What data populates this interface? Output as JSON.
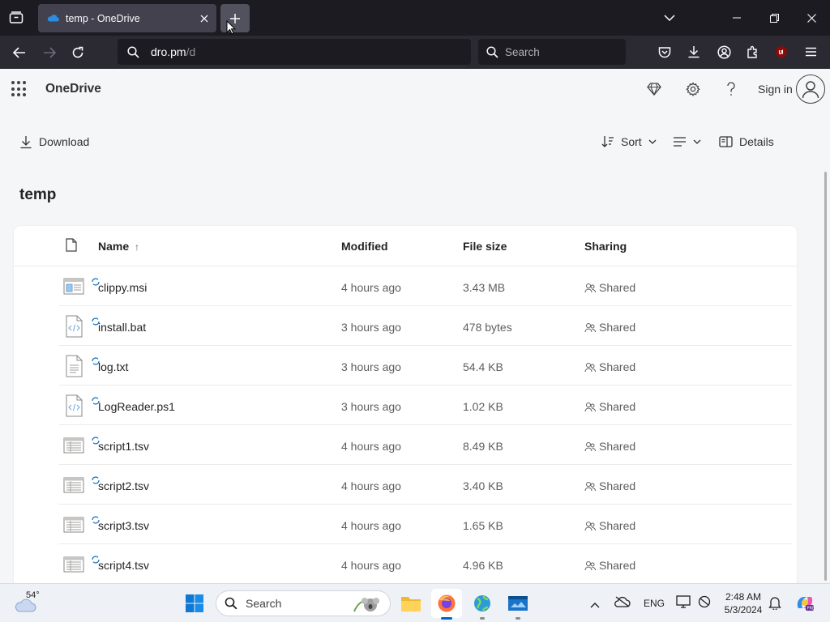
{
  "browser": {
    "tab_title": "temp - OneDrive",
    "url_host": "dro.pm",
    "url_path": "/d",
    "search_placeholder": "Search",
    "colors": {
      "tabbar": "#1c1b22",
      "toolbar": "#2b2a33",
      "active_tab": "#42414d"
    }
  },
  "app": {
    "name": "OneDrive",
    "signin_label": "Sign in"
  },
  "commandbar": {
    "download_label": "Download",
    "sort_label": "Sort",
    "details_label": "Details"
  },
  "folder": {
    "title": "temp"
  },
  "file_list": {
    "columns": {
      "name": "Name",
      "modified": "Modified",
      "size": "File size",
      "sharing": "Sharing"
    },
    "sort_indicator": "↑",
    "rows": [
      {
        "name": "clippy.msi",
        "modified": "4 hours ago",
        "size": "3.43 MB",
        "sharing": "Shared",
        "icon": "msi-file-icon"
      },
      {
        "name": "install.bat",
        "modified": "3 hours ago",
        "size": "478 bytes",
        "sharing": "Shared",
        "icon": "code-file-icon"
      },
      {
        "name": "log.txt",
        "modified": "3 hours ago",
        "size": "54.4 KB",
        "sharing": "Shared",
        "icon": "text-file-icon"
      },
      {
        "name": "LogReader.ps1",
        "modified": "3 hours ago",
        "size": "1.02 KB",
        "sharing": "Shared",
        "icon": "code-file-icon"
      },
      {
        "name": "script1.tsv",
        "modified": "4 hours ago",
        "size": "8.49 KB",
        "sharing": "Shared",
        "icon": "spreadsheet-file-icon"
      },
      {
        "name": "script2.tsv",
        "modified": "4 hours ago",
        "size": "3.40 KB",
        "sharing": "Shared",
        "icon": "spreadsheet-file-icon"
      },
      {
        "name": "script3.tsv",
        "modified": "4 hours ago",
        "size": "1.65 KB",
        "sharing": "Shared",
        "icon": "spreadsheet-file-icon"
      },
      {
        "name": "script4.tsv",
        "modified": "4 hours ago",
        "size": "4.96 KB",
        "sharing": "Shared",
        "icon": "spreadsheet-file-icon"
      }
    ]
  },
  "taskbar": {
    "weather_temp": "54°",
    "search_label": "Search",
    "language": "ENG",
    "time": "2:48 AM",
    "date": "5/3/2024"
  }
}
